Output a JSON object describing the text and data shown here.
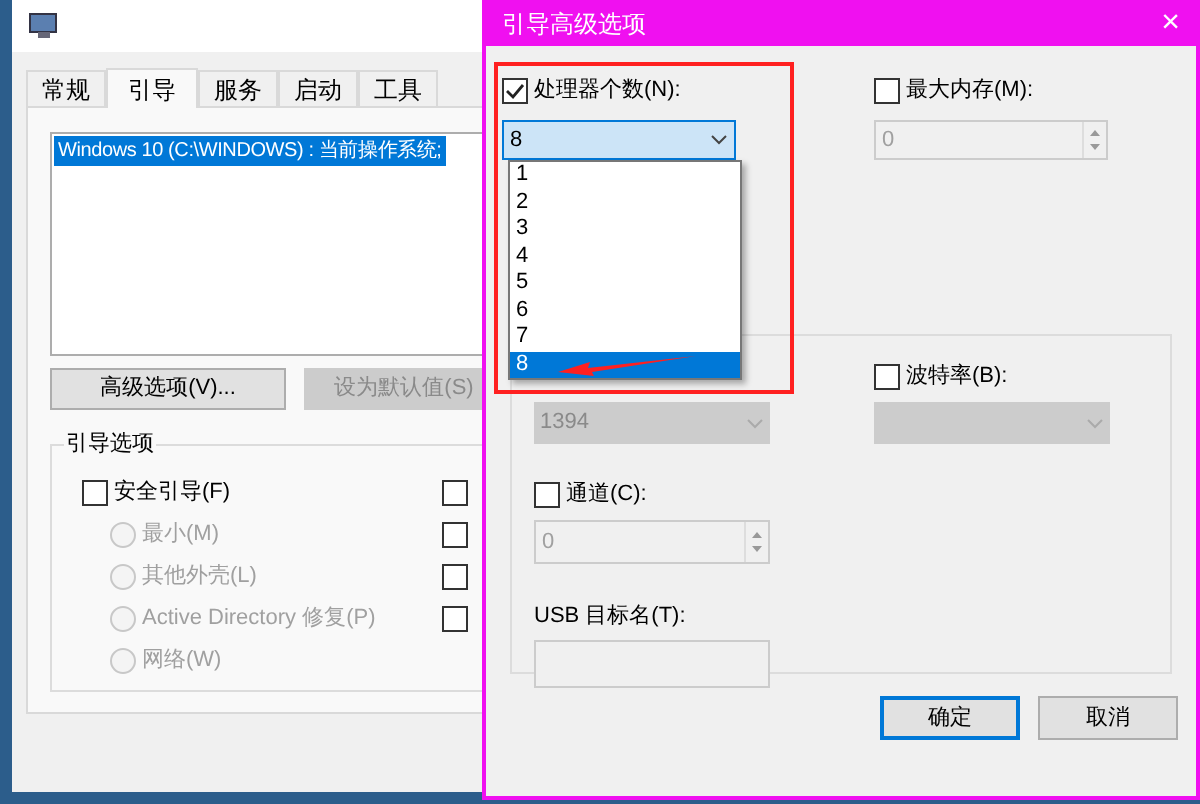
{
  "main_window": {
    "tabs": [
      {
        "label": "常规",
        "selected": false
      },
      {
        "label": "引导",
        "selected": true
      },
      {
        "label": "服务",
        "selected": false
      },
      {
        "label": "启动",
        "selected": false
      },
      {
        "label": "工具",
        "selected": false
      }
    ],
    "boot_list": [
      {
        "label": "Windows 10 (C:\\WINDOWS) : 当前操作系统;",
        "selected": true
      }
    ],
    "buttons": [
      {
        "label": "高级选项(V)...",
        "disabled": false
      },
      {
        "label": "设为默认值(S)",
        "disabled": true
      }
    ],
    "boot_options": {
      "title": "引导选项",
      "safe_boot": {
        "label": "安全引导(F)",
        "checked": false
      },
      "radios": [
        {
          "label": "最小(M)",
          "selected": false,
          "disabled": true
        },
        {
          "label": "其他外壳(L)",
          "selected": false,
          "disabled": true
        },
        {
          "label": "Active Directory 修复(P)",
          "selected": false,
          "disabled": true
        },
        {
          "label": "网络(W)",
          "selected": false,
          "disabled": true
        }
      ],
      "right_checks": [
        {
          "checked": false
        },
        {
          "checked": false
        },
        {
          "checked": false
        },
        {
          "checked": false
        }
      ]
    }
  },
  "dialog": {
    "title": "引导高级选项",
    "close": "×",
    "processors": {
      "label": "处理器个数(N):",
      "checked": true,
      "value": "8",
      "options": [
        {
          "label": "1",
          "selected": false
        },
        {
          "label": "2",
          "selected": false
        },
        {
          "label": "3",
          "selected": false
        },
        {
          "label": "4",
          "selected": false
        },
        {
          "label": "5",
          "selected": false
        },
        {
          "label": "6",
          "selected": false
        },
        {
          "label": "7",
          "selected": false
        },
        {
          "label": "8",
          "selected": true
        }
      ]
    },
    "max_memory": {
      "label": "最大内存(M):",
      "checked": false,
      "value": "0"
    },
    "debug_port": {
      "value": "1394"
    },
    "baud_rate": {
      "label": "波特率(B):",
      "checked": false
    },
    "channel": {
      "label": "通道(C):",
      "checked": false,
      "value": "0"
    },
    "usb_target": {
      "label": "USB 目标名(T):"
    },
    "buttons": [
      {
        "label": "确定",
        "default": true
      },
      {
        "label": "取消",
        "default": false
      }
    ]
  }
}
